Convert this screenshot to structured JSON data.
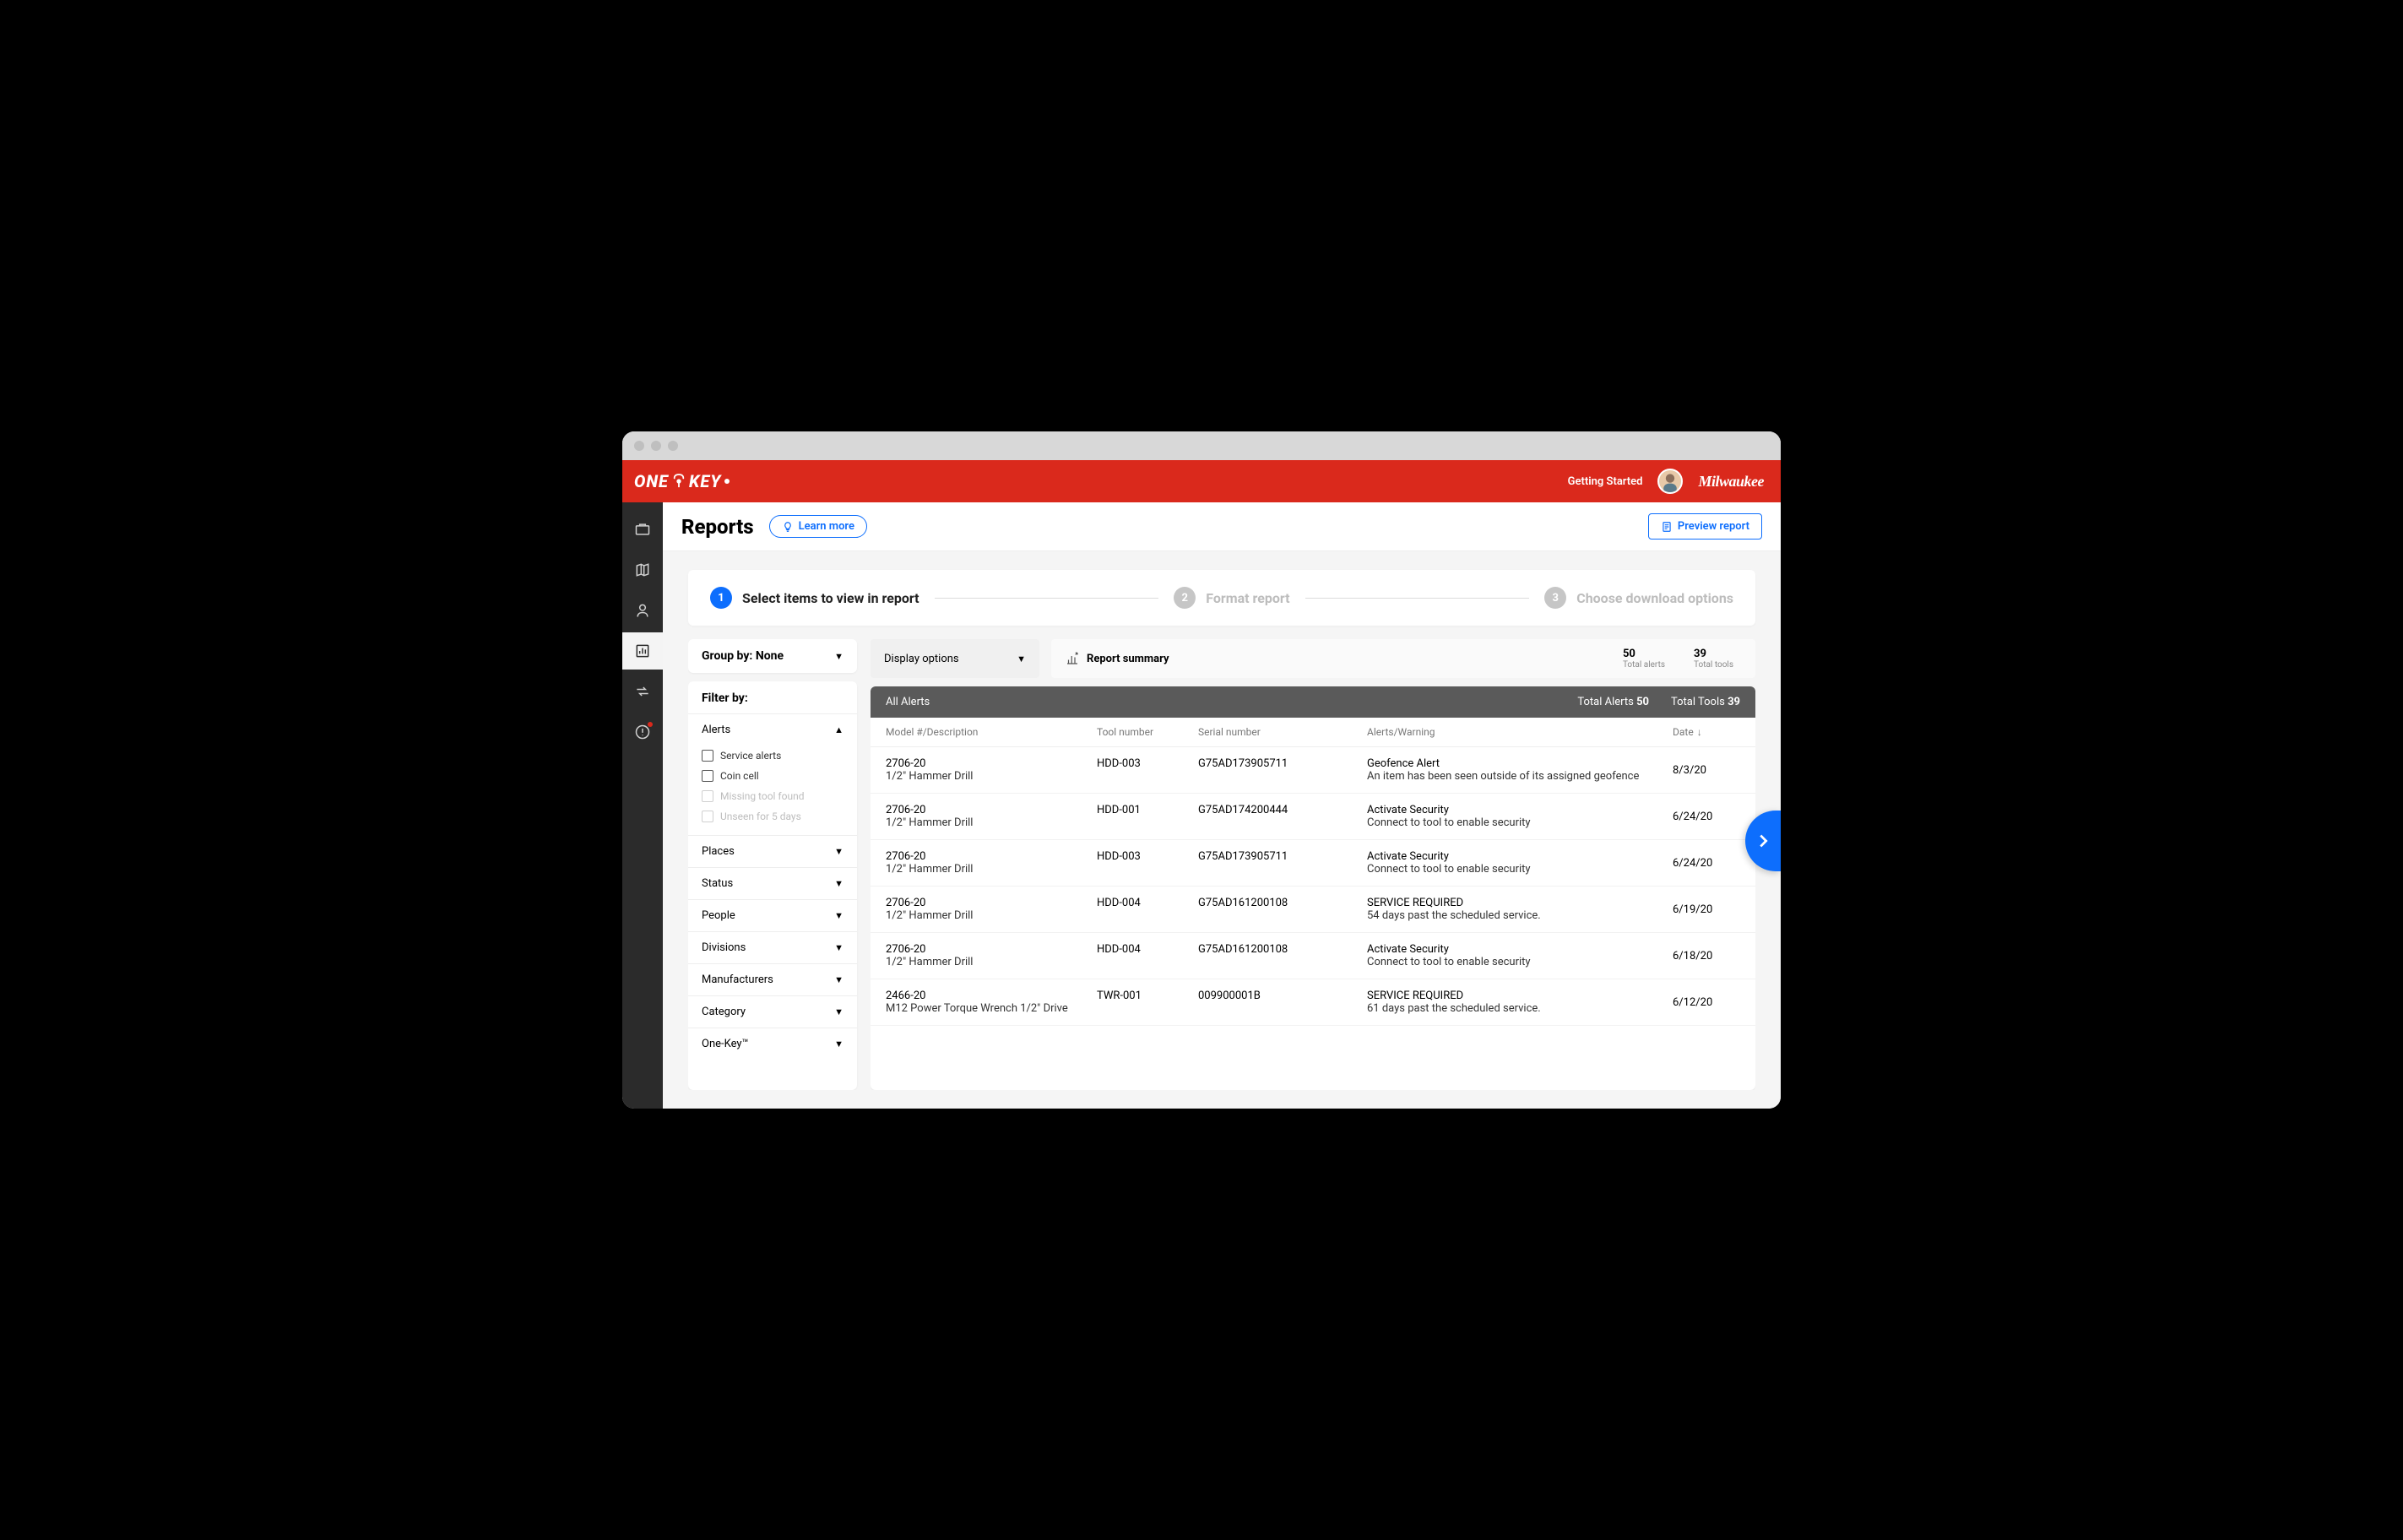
{
  "header": {
    "logo_left": "ONE",
    "logo_right": "KEY",
    "getting_started": "Getting Started",
    "brand": "Milwaukee"
  },
  "page": {
    "title": "Reports",
    "learn_more": "Learn more",
    "preview": "Preview report"
  },
  "stepper": {
    "s1_num": "1",
    "s1_label": "Select items to view in report",
    "s2_num": "2",
    "s2_label": "Format report",
    "s3_num": "3",
    "s3_label": "Choose download options"
  },
  "groupby": {
    "label": "Group by: None"
  },
  "filters": {
    "title": "Filter by:",
    "alerts": {
      "label": "Alerts",
      "opts": {
        "service": "Service alerts",
        "coin": "Coin cell",
        "missing": "Missing tool found",
        "unseen": "Unseen for 5 days"
      }
    },
    "places": "Places",
    "status": "Status",
    "people": "People",
    "divisions": "Divisions",
    "manufacturers": "Manufacturers",
    "category": "Category",
    "onekey": "One-Key™"
  },
  "display_options": "Display options",
  "summary": {
    "title": "Report summary",
    "alerts_val": "50",
    "alerts_lab": "Total alerts",
    "tools_val": "39",
    "tools_lab": "Total tools"
  },
  "table": {
    "title": "All Alerts",
    "total_alerts_lab": "Total Alerts",
    "total_alerts_val": "50",
    "total_tools_lab": "Total Tools",
    "total_tools_val": "39",
    "cols": {
      "model": "Model #/Description",
      "tool": "Tool number",
      "serial": "Serial number",
      "alert": "Alerts/Warning",
      "date": "Date"
    },
    "rows": [
      {
        "model": "2706-20",
        "desc": "1/2\" Hammer Drill",
        "tool": "HDD-003",
        "serial": "G75AD173905711",
        "alert": "Geofence Alert",
        "alert_desc": "An item has been seen outside of its assigned geofence",
        "date": "8/3/20"
      },
      {
        "model": "2706-20",
        "desc": "1/2\" Hammer Drill",
        "tool": "HDD-001",
        "serial": "G75AD174200444",
        "alert": "Activate Security",
        "alert_desc": "Connect to tool to enable security",
        "date": "6/24/20"
      },
      {
        "model": "2706-20",
        "desc": "1/2\" Hammer Drill",
        "tool": "HDD-003",
        "serial": "G75AD173905711",
        "alert": "Activate Security",
        "alert_desc": "Connect to tool to enable security",
        "date": "6/24/20"
      },
      {
        "model": "2706-20",
        "desc": "1/2\" Hammer Drill",
        "tool": "HDD-004",
        "serial": "G75AD161200108",
        "alert": "SERVICE REQUIRED",
        "alert_desc": "54 days past the scheduled service.",
        "date": "6/19/20"
      },
      {
        "model": "2706-20",
        "desc": "1/2\" Hammer Drill",
        "tool": "HDD-004",
        "serial": "G75AD161200108",
        "alert": "Activate Security",
        "alert_desc": "Connect to tool to enable security",
        "date": "6/18/20"
      },
      {
        "model": "2466-20",
        "desc": "M12 Power Torque Wrench 1/2\" Drive",
        "tool": "TWR-001",
        "serial": "009900001B",
        "alert": "SERVICE REQUIRED",
        "alert_desc": "61 days past the scheduled service.",
        "date": "6/12/20"
      }
    ]
  }
}
